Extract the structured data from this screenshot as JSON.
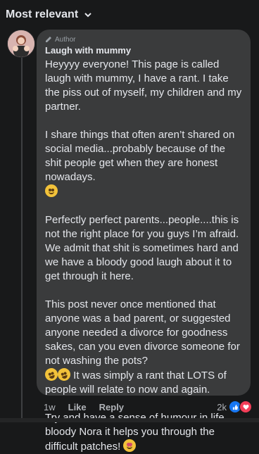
{
  "sort": {
    "label": "Most relevant"
  },
  "comment": {
    "badge": "Author",
    "author": "Laugh with mummy",
    "paragraphs": [
      "Heyyyy everyone! This page is called laugh with mummy, I have a rant. I take the piss out of myself, my children and my partner.",
      "I share things that often aren’t shared on social media...probably because of the shit people get when they are honest nowadays.",
      "Perfectly perfect parents...people....this is not the right place for you guys I’m afraid. We admit that shit is sometimes hard and we have a bloody good laugh about it to get through it here.",
      "This post never once mentioned that anyone was a bad parent, or suggested anyone needed a divorce for goodness sakes, can you even divorce someone for not washing the pots?",
      "It was simply a rant that LOTS of people will relate to now and again.",
      "Try and have a sense of humour in life, bloody Nora it helps you through the difficult patches!"
    ],
    "time": "1w",
    "like_label": "Like",
    "reply_label": "Reply",
    "reaction_count": "2k"
  },
  "icons": {
    "sort_toggle": "chevron-down-icon",
    "badge": "pencil-icon",
    "emoji_1": "eye-roll-emoji",
    "emoji_2": "rolling-on-floor-laughing-emoji",
    "emoji_3": "smiling-face-with-hearts-emoji",
    "reaction_1": "like-reaction-icon",
    "reaction_2": "love-reaction-icon"
  }
}
